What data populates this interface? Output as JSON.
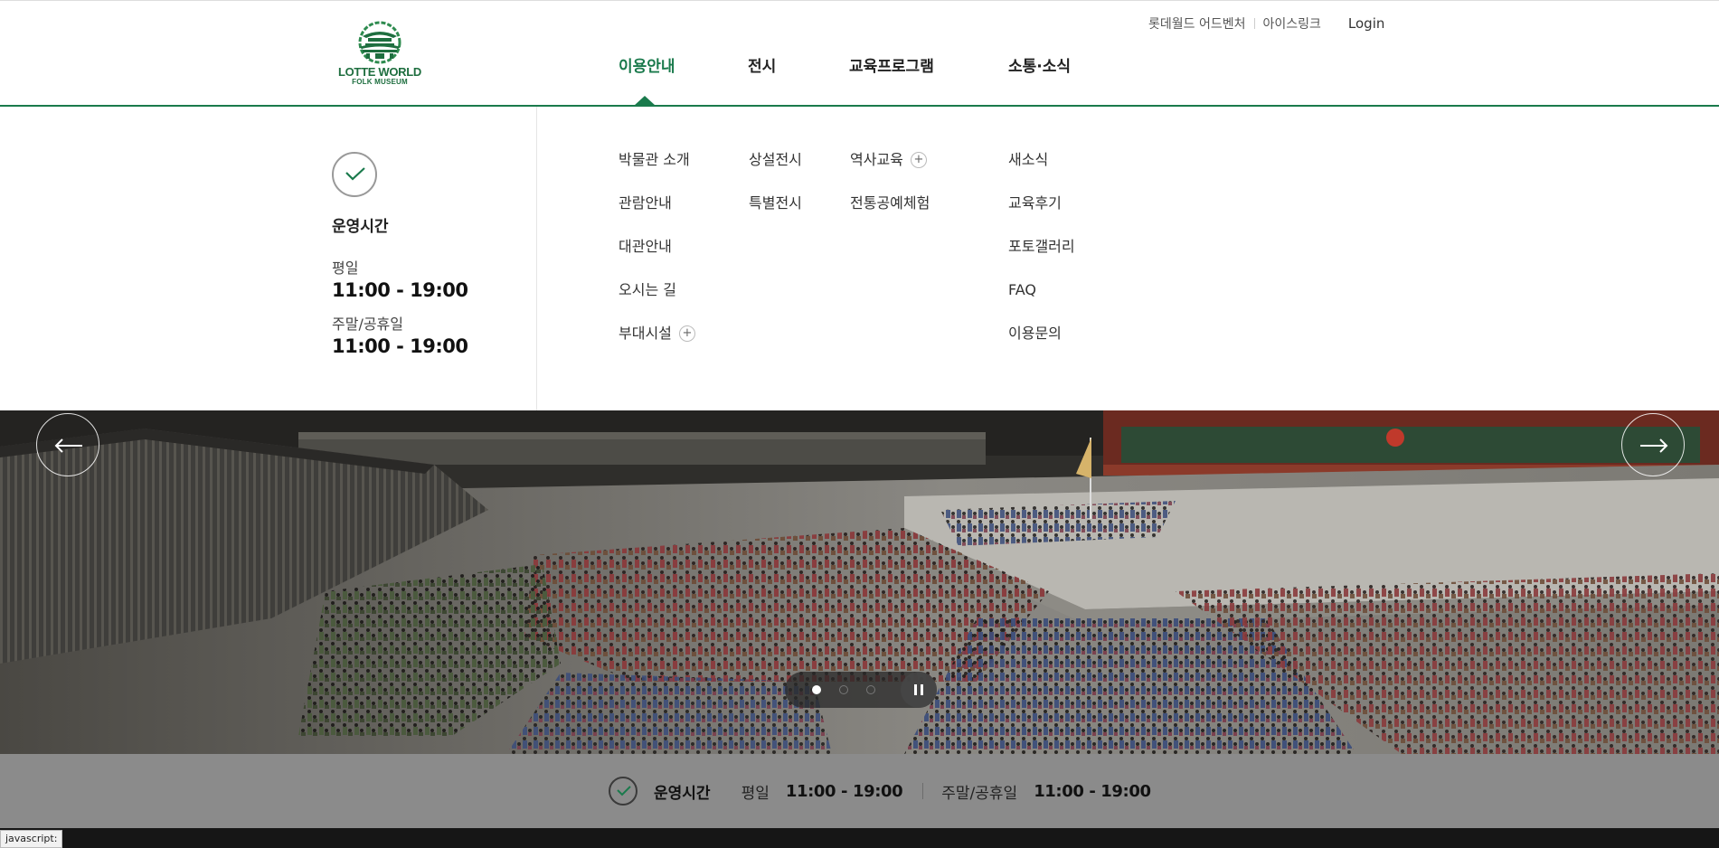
{
  "header": {
    "logo": {
      "name": "LOTTE WORLD",
      "sub": "FOLK MUSEUM"
    },
    "util_links": [
      "롯데월드 어드벤처",
      "아이스링크"
    ],
    "login_label": "Login",
    "gnb": [
      {
        "label": "이용안내",
        "active": true
      },
      {
        "label": "전시",
        "active": false
      },
      {
        "label": "교육프로그램",
        "active": false
      },
      {
        "label": "소통·소식",
        "active": false
      }
    ],
    "accent_color": "#1a7a4c"
  },
  "mega_menu": {
    "hours": {
      "icon": "clock-check-icon",
      "title": "운영시간",
      "weekday_label": "평일",
      "weekday_time": "11:00 - 19:00",
      "weekend_label": "주말/공휴일",
      "weekend_time": "11:00 - 19:00"
    },
    "columns": [
      {
        "items": [
          {
            "label": "박물관 소개"
          },
          {
            "label": "관람안내"
          },
          {
            "label": "대관안내"
          },
          {
            "label": "오시는 길"
          },
          {
            "label": "부대시설",
            "expand": "+"
          }
        ]
      },
      {
        "items": [
          {
            "label": "상설전시"
          },
          {
            "label": "특별전시"
          }
        ]
      },
      {
        "items": [
          {
            "label": "역사교육",
            "expand": "+"
          },
          {
            "label": "전통공예체험"
          }
        ]
      },
      {
        "items": [
          {
            "label": "새소식"
          },
          {
            "label": "교육후기"
          },
          {
            "label": "포토갤러리"
          },
          {
            "label": "FAQ"
          },
          {
            "label": "이용문의"
          }
        ]
      }
    ]
  },
  "hero": {
    "prev_icon": "arrow-left-icon",
    "next_icon": "arrow-right-icon",
    "slide_count": 3,
    "active_slide": 1,
    "pause_icon": "pause-icon"
  },
  "info_bar": {
    "title": "운영시간",
    "weekday_label": "평일",
    "weekday_time": "11:00 - 19:00",
    "weekend_label": "주말/공휴일",
    "weekend_time": "11:00 - 19:00"
  },
  "status_bar": {
    "text": "javascript:"
  }
}
